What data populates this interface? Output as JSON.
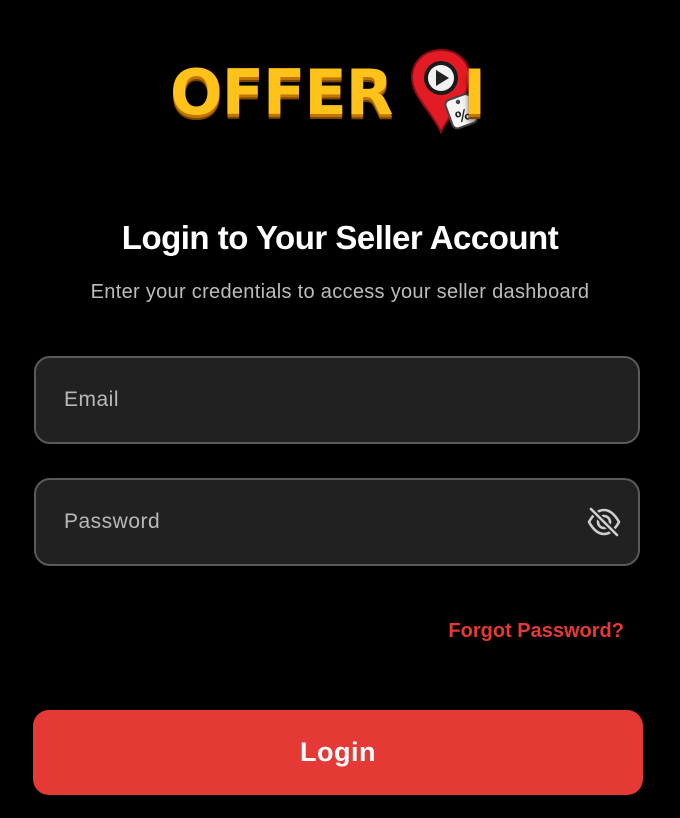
{
  "logo": {
    "text_before_pin": "OFFER",
    "text_after_pin": "I",
    "pin_icon": "map-pin-play-discount-icon",
    "pin_badge_symbol": "%",
    "colors": {
      "text": "#ffc21a",
      "pin": "#e21b24"
    }
  },
  "header": {
    "title": "Login to Your Seller Account",
    "subtitle": "Enter your credentials to access your seller dashboard"
  },
  "form": {
    "email": {
      "placeholder": "Email",
      "value": ""
    },
    "password": {
      "placeholder": "Password",
      "value": "",
      "toggle_icon": "eye-off-icon"
    },
    "forgot_password_label": "Forgot Password?",
    "login_label": "Login"
  },
  "colors": {
    "background": "#000000",
    "field_background": "#212121",
    "field_border": "#5a5a5a",
    "accent": "#e53935",
    "subtitle_text": "#bdbdbd"
  }
}
